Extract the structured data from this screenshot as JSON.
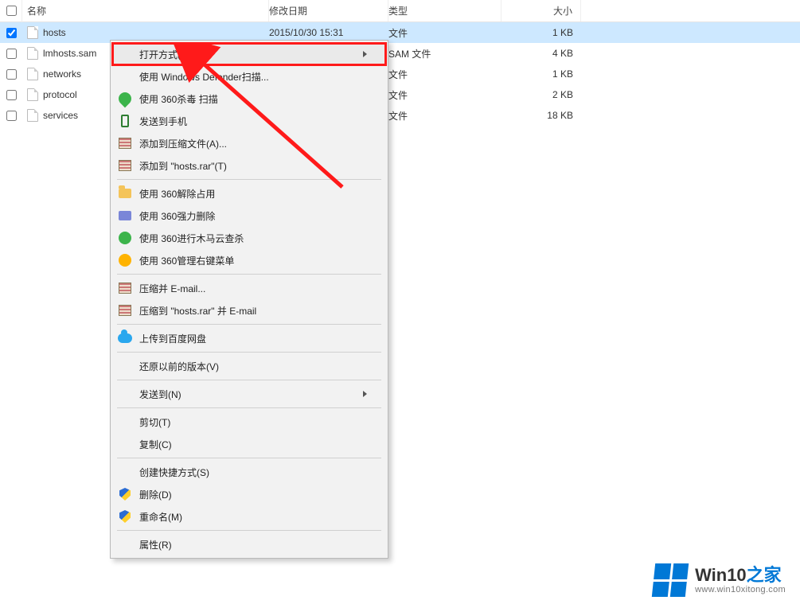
{
  "columns": {
    "name": "名称",
    "date": "修改日期",
    "type": "类型",
    "size": "大小"
  },
  "files": [
    {
      "name": "hosts",
      "date": "2015/10/30 15:31",
      "type": "文件",
      "size": "1 KB",
      "checked": true
    },
    {
      "name": "lmhosts.sam",
      "date": "",
      "type": "SAM 文件",
      "size": "4 KB",
      "checked": false
    },
    {
      "name": "networks",
      "date": "",
      "type": "文件",
      "size": "1 KB",
      "checked": false
    },
    {
      "name": "protocol",
      "date": "",
      "type": "文件",
      "size": "2 KB",
      "checked": false
    },
    {
      "name": "services",
      "date": "",
      "type": "文件",
      "size": "18 KB",
      "checked": false
    }
  ],
  "menu": {
    "open_with": "打开方式(H)",
    "defender_scan": "使用 Windows Defender扫描...",
    "scan_360": "使用 360杀毒 扫描",
    "send_phone": "发送到手机",
    "add_archive": "添加到压缩文件(A)...",
    "add_hosts_rar": "添加到 \"hosts.rar\"(T)",
    "unlock_360": "使用 360解除占用",
    "forcedel_360": "使用 360强力删除",
    "trojan_360": "使用 360进行木马云查杀",
    "manage_360": "使用 360管理右键菜单",
    "zip_email": "压缩并 E-mail...",
    "zip_hosts_email": "压缩到 \"hosts.rar\" 并 E-mail",
    "baidu_upload": "上传到百度网盘",
    "restore_prev": "还原以前的版本(V)",
    "send_to": "发送到(N)",
    "cut": "剪切(T)",
    "copy": "复制(C)",
    "shortcut": "创建快捷方式(S)",
    "delete": "删除(D)",
    "rename": "重命名(M)",
    "properties": "属性(R)"
  },
  "watermark": {
    "title_a": "Win10",
    "title_b": "之家",
    "url": "www.win10xitong.com"
  }
}
